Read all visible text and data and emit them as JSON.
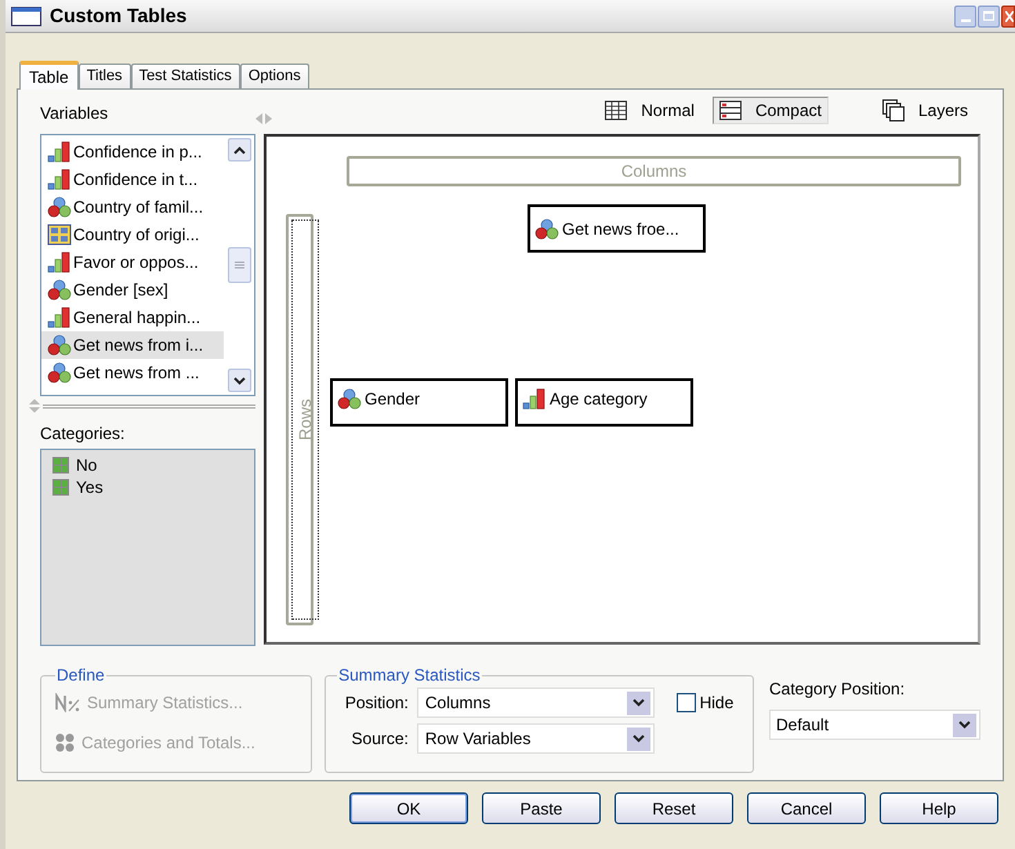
{
  "window": {
    "title": "Custom Tables"
  },
  "tabs": [
    {
      "label": "Table",
      "selected": true
    },
    {
      "label": "Titles",
      "selected": false
    },
    {
      "label": "Test Statistics",
      "selected": false
    },
    {
      "label": "Options",
      "selected": false
    }
  ],
  "variables": {
    "label": "Variables",
    "items": [
      {
        "label": "Confidence in p...",
        "kind": "scale",
        "selected": false
      },
      {
        "label": "Confidence in t...",
        "kind": "scale",
        "selected": false
      },
      {
        "label": "Country of famil...",
        "kind": "nominal",
        "selected": false
      },
      {
        "label": "Country of origi...",
        "kind": "set",
        "selected": false
      },
      {
        "label": "Favor or oppos...",
        "kind": "scale",
        "selected": false
      },
      {
        "label": "Gender [sex]",
        "kind": "nominal",
        "selected": false
      },
      {
        "label": "General happin...",
        "kind": "scale",
        "selected": false
      },
      {
        "label": "Get news from i...",
        "kind": "nominal",
        "selected": true
      },
      {
        "label": "Get news from ...",
        "kind": "nominal",
        "selected": false
      }
    ]
  },
  "categories": {
    "label": "Categories:",
    "items": [
      "No",
      "Yes"
    ]
  },
  "view_options": [
    {
      "label": "Normal",
      "kind": "normal",
      "selected": false
    },
    {
      "label": "Compact",
      "kind": "compact",
      "selected": true
    },
    {
      "label": "Layers",
      "kind": "layers",
      "selected": false
    }
  ],
  "canvas": {
    "columns_label": "Columns",
    "rows_label": "Rows",
    "column_variables": [
      {
        "label": "Get news froe...",
        "kind": "nominal"
      }
    ],
    "row_variables": [
      {
        "label": "Gender",
        "kind": "nominal"
      },
      {
        "label": "Age category",
        "kind": "scale"
      }
    ]
  },
  "define": {
    "title": "Define",
    "items": [
      {
        "label": "Summary Statistics...",
        "kind": "stats",
        "disabled": true
      },
      {
        "label": "Categories and Totals...",
        "kind": "categories",
        "disabled": true
      }
    ]
  },
  "summary_statistics": {
    "title": "Summary Statistics",
    "position_label": "Position:",
    "position_value": "Columns",
    "hide": {
      "label": "Hide",
      "checked": false
    },
    "source_label": "Source:",
    "source_value": "Row Variables"
  },
  "category_position": {
    "label": "Category Position:",
    "value": "Default"
  },
  "buttons": [
    {
      "label": "OK",
      "default": true
    },
    {
      "label": "Paste",
      "default": false
    },
    {
      "label": "Reset",
      "default": false
    },
    {
      "label": "Cancel",
      "default": false
    },
    {
      "label": "Help",
      "default": false
    }
  ]
}
